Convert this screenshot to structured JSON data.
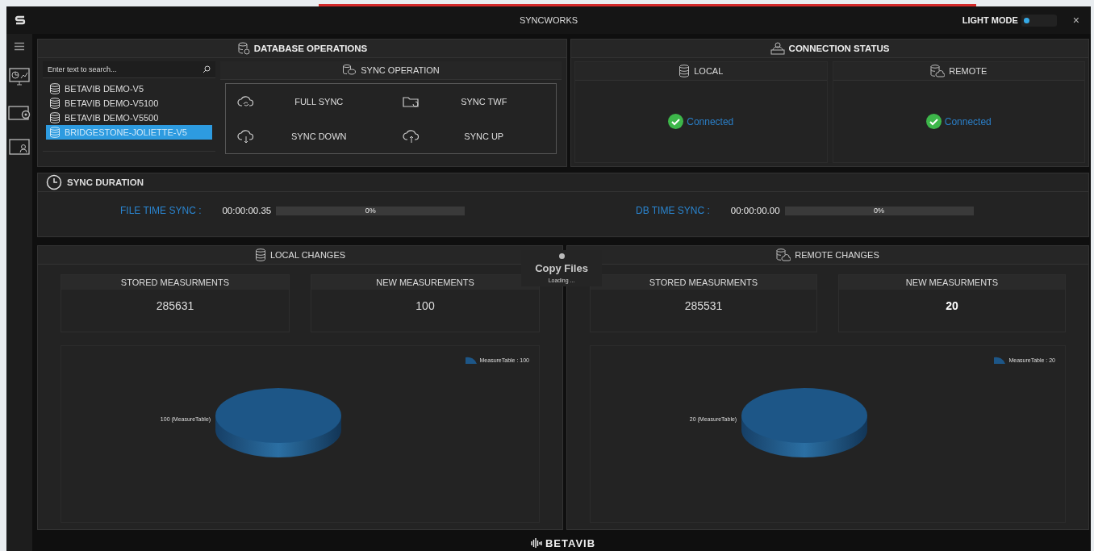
{
  "window": {
    "title": "SYNCWORKS",
    "light_mode": {
      "label": "LIGHT MODE",
      "on": false
    },
    "close": "×"
  },
  "database_operations": {
    "title": "DATABASE OPERATIONS",
    "search": {
      "placeholder": "Enter text to search..."
    },
    "databases": [
      {
        "name": "BETAVIB DEMO-V5",
        "selected": false
      },
      {
        "name": "BETAVIB DEMO-V5100",
        "selected": false
      },
      {
        "name": "BETAVIB DEMO-V5500",
        "selected": false
      },
      {
        "name": "BRIDGESTONE-JOLIETTE-V5",
        "selected": true
      }
    ],
    "sync_operation": {
      "title": "SYNC OPERATION",
      "buttons": [
        {
          "label": "FULL SYNC",
          "kind": "cloud"
        },
        {
          "label": "SYNC TWF",
          "kind": "folder"
        },
        {
          "label": "SYNC DOWN",
          "kind": "down"
        },
        {
          "label": "SYNC UP",
          "kind": "up"
        }
      ]
    }
  },
  "connection_status": {
    "title": "CONNECTION STATUS",
    "columns": [
      {
        "title": "LOCAL",
        "kind": "local",
        "status": "Connected"
      },
      {
        "title": "REMOTE",
        "kind": "remote",
        "status": "Connected"
      }
    ]
  },
  "sync_duration": {
    "title": "SYNC DURATION",
    "items": [
      {
        "label": "FILE TIME SYNC :",
        "time": "00:00:00.35",
        "level": 0,
        "percent": "0%"
      },
      {
        "label": "DB TIME SYNC :",
        "time": "00:00:00.00",
        "level": 0,
        "percent": "0%"
      }
    ]
  },
  "changes": [
    {
      "title": "LOCAL CHANGES",
      "kind": "local",
      "stored_label": "STORED MEASURMENTS",
      "stored": "285631",
      "new_label": "NEW MEASUREMENTS",
      "new": "100",
      "new_bold": false,
      "legend": "MeasureTable : 100",
      "label": "100 (MeasureTable)"
    },
    {
      "title": "REMOTE CHANGES",
      "kind": "remote",
      "stored_label": "STORED MEASURMENTS",
      "stored": "285531",
      "new_label": "NEW MEASURMENTS",
      "new": "20",
      "new_bold": true,
      "legend": "MeasureTable : 20",
      "label": "20 (MeasureTable)"
    }
  ],
  "loading": {
    "title": "Copy Files",
    "text": "Loading ..."
  },
  "footer": {
    "logo": "BETAVIB"
  }
}
